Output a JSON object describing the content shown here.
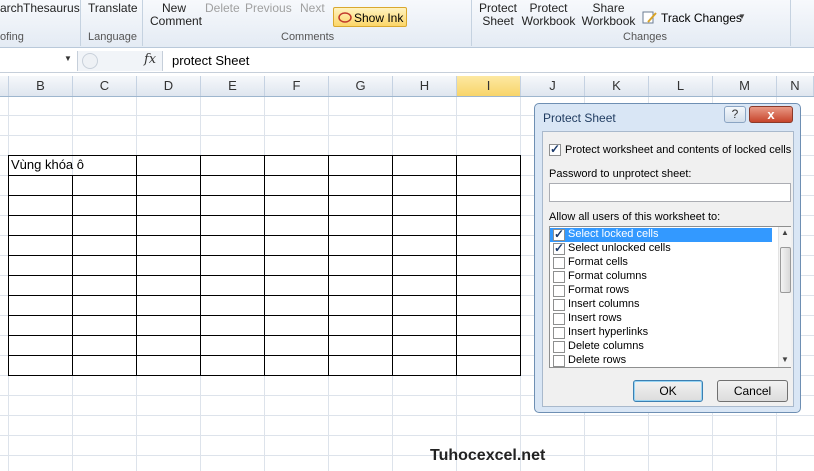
{
  "ribbon": {
    "buttons": {
      "research": "arch",
      "thesaurus": "Thesaurus",
      "translate": "Translate",
      "new_comment_1": "New",
      "new_comment_2": "Comment",
      "delete": "Delete",
      "previous": "Previous",
      "next": "Next",
      "show_ink": "Show Ink",
      "protect_sheet_1": "Protect",
      "protect_sheet_2": "Sheet",
      "protect_workbook_1": "Protect",
      "protect_workbook_2": "Workbook",
      "share_workbook_1": "Share",
      "share_workbook_2": "Workbook",
      "track_changes": "Track Changes"
    },
    "groups": {
      "proofing": "ofing",
      "language": "Language",
      "comments": "Comments",
      "changes": "Changes"
    }
  },
  "formula_bar": {
    "fx": "fx",
    "value": "protect Sheet"
  },
  "columns": [
    "B",
    "C",
    "D",
    "E",
    "F",
    "G",
    "H",
    "I",
    "J",
    "K",
    "L",
    "M",
    "N"
  ],
  "selected_column": "I",
  "cells": {
    "b8": "Vùng khóa ô"
  },
  "watermark": "Tuhocexcel.net",
  "dialog": {
    "title": "Protect Sheet",
    "help": "?",
    "close": "x",
    "protect_contents_label": "Protect worksheet and contents of locked cells",
    "protect_contents_checked": true,
    "password_label": "Password to unprotect sheet:",
    "password_value": "",
    "allow_label": "Allow all users of this worksheet to:",
    "permissions": [
      {
        "label": "Select locked cells",
        "checked": true,
        "highlighted": true
      },
      {
        "label": "Select unlocked cells",
        "checked": true,
        "highlighted": false
      },
      {
        "label": "Format cells",
        "checked": false,
        "highlighted": false
      },
      {
        "label": "Format columns",
        "checked": false,
        "highlighted": false
      },
      {
        "label": "Format rows",
        "checked": false,
        "highlighted": false
      },
      {
        "label": "Insert columns",
        "checked": false,
        "highlighted": false
      },
      {
        "label": "Insert rows",
        "checked": false,
        "highlighted": false
      },
      {
        "label": "Insert hyperlinks",
        "checked": false,
        "highlighted": false
      },
      {
        "label": "Delete columns",
        "checked": false,
        "highlighted": false
      },
      {
        "label": "Delete rows",
        "checked": false,
        "highlighted": false
      }
    ],
    "ok": "OK",
    "cancel": "Cancel"
  }
}
